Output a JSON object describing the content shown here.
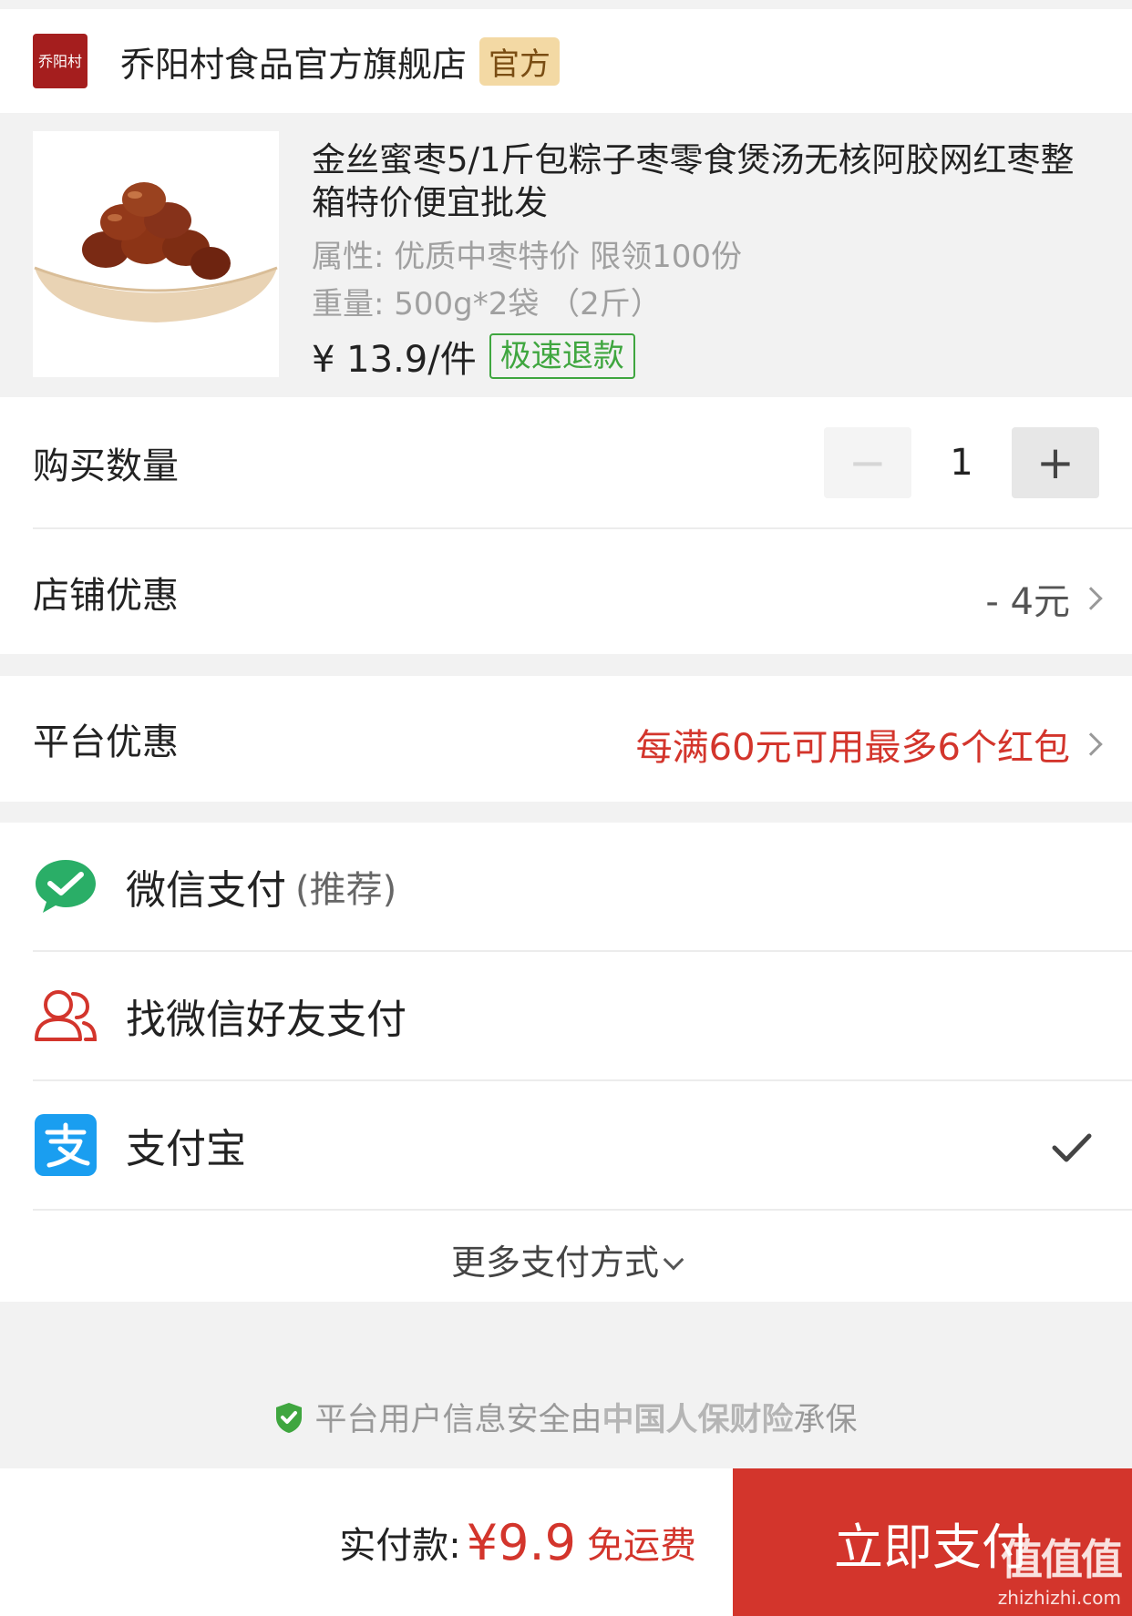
{
  "store": {
    "logo_text": "乔阳村",
    "name": "乔阳村食品官方旗舰店",
    "badge": "官方"
  },
  "product": {
    "title": "金丝蜜枣5/1斤包粽子枣零食煲汤无核阿胶网红枣整箱特价便宜批发",
    "attribute": "属性: 优质中枣特价 限领100份",
    "weight": "重量: 500g*2袋 （2斤）",
    "price": "¥ 13.9/件",
    "refund_badge": "极速退款"
  },
  "quantity": {
    "label": "购买数量",
    "minus": "−",
    "value": "1",
    "plus": "+"
  },
  "store_discount": {
    "label": "店铺优惠",
    "value": "- 4元"
  },
  "platform_discount": {
    "label": "平台优惠",
    "value": "每满60元可用最多6个红包",
    "color": "#d3352c"
  },
  "payment": {
    "wechat": {
      "label": "微信支付",
      "sub": "(推荐)",
      "icon": "wechat-pay-icon"
    },
    "friend": {
      "label": "找微信好友支付",
      "icon": "friends-icon"
    },
    "alipay": {
      "label": "支付宝",
      "icon": "alipay-icon",
      "selected": true
    },
    "more": "更多支付方式"
  },
  "security": {
    "prefix": "平台用户信息安全由",
    "insurer": "中国人保财险",
    "suffix": "承保"
  },
  "footer": {
    "total_label": "实付款:",
    "total_value": "¥9.9",
    "shipping": "免运费",
    "pay_button": "立即支付",
    "watermark_big": "值值值",
    "watermark_small": "zhizhizhi.com"
  },
  "colors": {
    "accent_red": "#d3352c",
    "green": "#3fa63f",
    "wechat_green": "#2aae67",
    "alipay_blue": "#1a9ef0"
  }
}
